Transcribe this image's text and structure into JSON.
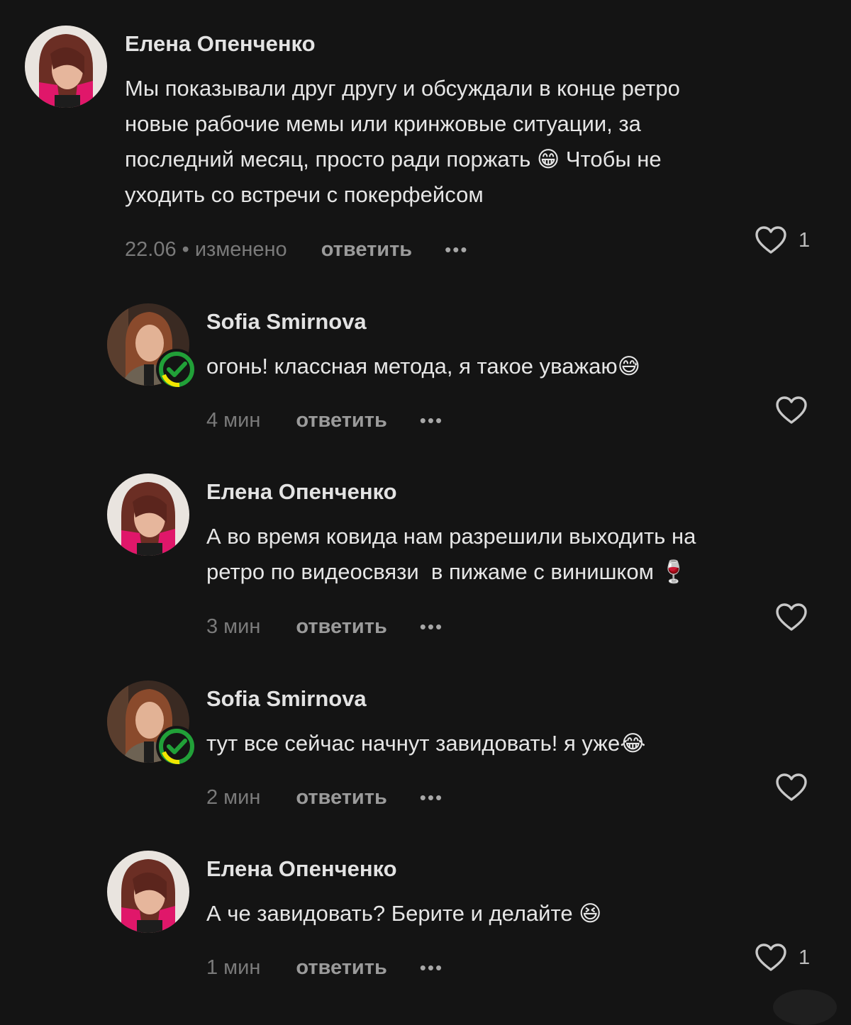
{
  "colors": {
    "background": "#141414",
    "badge_green": "#21a038",
    "badge_yellow": "#f2e600",
    "avatar_pink": "#e0176a"
  },
  "comments": [
    {
      "author": "Елена Опенченко",
      "text": "Мы показывали друг другу и обсуждали в конце ретро\nновые рабочие мемы или кринжовые ситуации, за\nпоследний месяц, просто ради поржать",
      "emoji": "😁",
      "text_tail": " Чтобы не\nуходить со встречи с покерфейсом",
      "time": "22.06 • изменено",
      "reply_label": "ответить",
      "more_label": "•••",
      "likes": "1"
    },
    {
      "author": "Sofia Smirnova",
      "text": "огонь! классная метода, я такое уважаю",
      "emoji": "😅",
      "time": "4 мин",
      "reply_label": "ответить",
      "more_label": "•••",
      "likes": ""
    },
    {
      "author": "Елена Опенченко",
      "text": "А во время ковида нам разрешили выходить на\nретро по видеосвязи  в пижаме с винишком ",
      "emoji": "🍷",
      "time": "3 мин",
      "reply_label": "ответить",
      "more_label": "•••",
      "likes": ""
    },
    {
      "author": "Sofia Smirnova",
      "text": "тут все сейчас начнут завидовать! я уже",
      "emoji": "😂",
      "time": "2 мин",
      "reply_label": "ответить",
      "more_label": "•••",
      "likes": ""
    },
    {
      "author": "Елена Опенченко",
      "text": "А че завидовать? Берите и делайте ",
      "emoji": "😆",
      "time": "1 мин",
      "reply_label": "ответить",
      "more_label": "•••",
      "likes": "1"
    }
  ]
}
